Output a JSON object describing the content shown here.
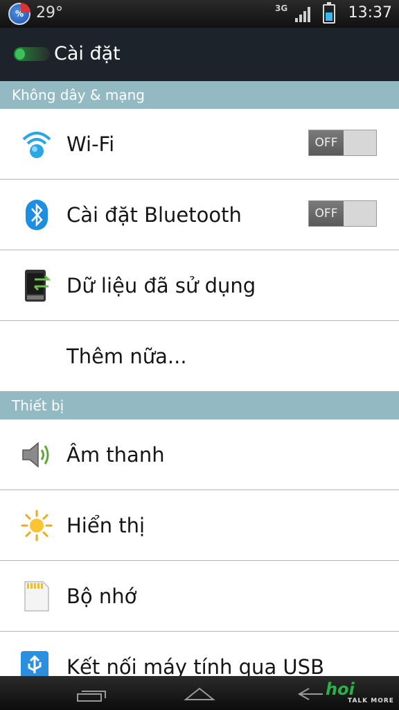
{
  "status_bar": {
    "battery_percent_icon": "%",
    "temperature": "29°",
    "network_type": "3G",
    "time": "13:37",
    "battery_level": 0.55
  },
  "action_bar": {
    "title": "Cài đặt",
    "logo_icon": "app-logo-icon"
  },
  "sections": [
    {
      "header": "Không dây & mạng",
      "items": [
        {
          "label": "Wi-Fi",
          "icon": "wifi-icon",
          "toggle": "OFF"
        },
        {
          "label": "Cài đặt Bluetooth",
          "icon": "bluetooth-icon",
          "toggle": "OFF"
        },
        {
          "label": "Dữ liệu đã sử dụng",
          "icon": "data-usage-icon"
        },
        {
          "label": "Thêm nữa...",
          "icon": ""
        }
      ]
    },
    {
      "header": "Thiết bị",
      "items": [
        {
          "label": "Âm thanh",
          "icon": "speaker-icon"
        },
        {
          "label": "Hiển thị",
          "icon": "sun-icon"
        },
        {
          "label": "Bộ nhớ",
          "icon": "sd-card-icon"
        },
        {
          "label": "Kết nối máy tính qua USB",
          "icon": "usb-icon"
        }
      ]
    }
  ],
  "nav_bar": {
    "buttons": [
      "recent-apps-icon",
      "home-icon",
      "back-icon"
    ]
  },
  "watermark": {
    "brand": "hoi",
    "tagline": "TALK MORE"
  },
  "colors": {
    "section_header": "#93b9c3",
    "action_bar": "#1c232b",
    "accent": "#39b8ef"
  }
}
